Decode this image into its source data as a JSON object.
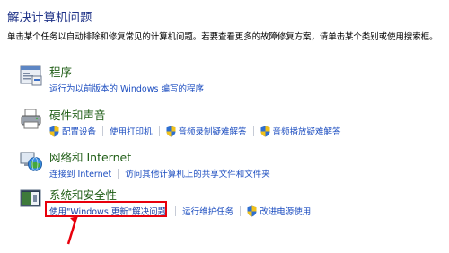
{
  "header": {
    "title": "解决计算机问题",
    "description": "单击某个任务以自动排除和修复常见的计算机问题。若要查看更多的故障修复方案，请单击某个类别或使用搜索框。"
  },
  "categories": [
    {
      "title": "程序",
      "icon": "programs-icon",
      "links": [
        {
          "label": "运行为以前版本的 Windows 编写的程序",
          "shield": false
        }
      ]
    },
    {
      "title": "硬件和声音",
      "icon": "printer-icon",
      "links": [
        {
          "label": "配置设备",
          "shield": true
        },
        {
          "label": "使用打印机",
          "shield": false
        },
        {
          "label": "音频录制疑难解答",
          "shield": true
        },
        {
          "label": "音频播放疑难解答",
          "shield": true
        }
      ]
    },
    {
      "title": "网络和 Internet",
      "icon": "network-globe-icon",
      "links": [
        {
          "label": "连接到 Internet",
          "shield": false
        },
        {
          "label": "访问其他计算机上的共享文件和文件夹",
          "shield": false
        }
      ]
    },
    {
      "title": "系统和安全性",
      "icon": "system-security-icon",
      "links": [
        {
          "label": "使用\"Windows 更新\"解决问题",
          "shield": false
        },
        {
          "label": "运行维护任务",
          "shield": false
        },
        {
          "label": "改进电源使用",
          "shield": true
        }
      ]
    }
  ],
  "annotations": {
    "highlight_color": "#e8000c",
    "highlighted_link": "使用\"Windows 更新\"解决问题"
  },
  "colors": {
    "title": "#1e3287",
    "category_title": "#1e5c14",
    "link": "#1d4ec0"
  }
}
